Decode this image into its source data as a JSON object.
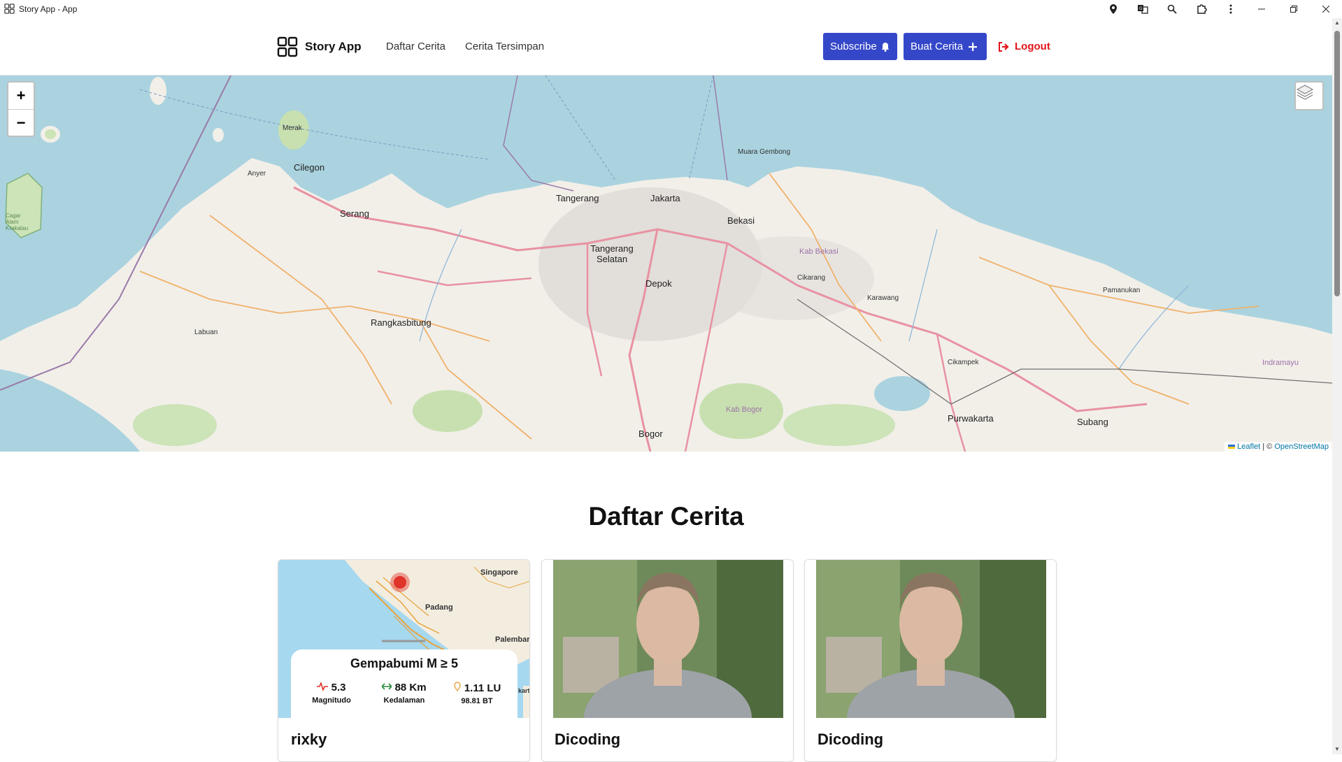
{
  "window": {
    "title": "Story App - App"
  },
  "nav": {
    "brand": "Story App",
    "links": [
      "Daftar Cerita",
      "Cerita Tersimpan"
    ],
    "subscribe": "Subscribe",
    "create": "Buat Cerita",
    "logout": "Logout"
  },
  "map": {
    "zoom_in": "+",
    "zoom_out": "−",
    "attribution_leaflet": "Leaflet",
    "attribution_sep": " | © ",
    "attribution_osm": "OpenStreetMap",
    "labels": {
      "jakarta": "Jakarta",
      "tangerang": "Tangerang",
      "tangerang_selatan": "Tangerang Selatan",
      "bekasi": "Bekasi",
      "depok": "Depok",
      "bogor": "Bogor",
      "serang": "Serang",
      "cilegon": "Cilegon",
      "rangkasbitung": "Rangkasbitung",
      "purwakarta": "Purwakarta",
      "subang": "Subang",
      "karawang": "Karawang",
      "cikampek": "Cikampek",
      "pulau_merak": "Merak",
      "cagar_alam": "Cagar Alam Krakatau",
      "kab_bekasi": "Kab Bekasi",
      "kab_bogor": "Kab Bogor",
      "indramayu": "Indramayu",
      "muara_gembong": "Muara Gembong",
      "pamanukan": "Pamanukan",
      "anyer": "Anyer",
      "labuan": "Labuan",
      "cikarang": "Cikarang"
    }
  },
  "section": {
    "title": "Daftar Cerita"
  },
  "cards": [
    {
      "title": "rixky",
      "quake": {
        "title": "Gempabumi M ≥ 5",
        "magnitude": "5.3",
        "magnitude_label": "Magnitudo",
        "depth": "88 Km",
        "depth_label": "Kedalaman",
        "location": "1.11 LU",
        "location_sub": "98.81 BT",
        "places": {
          "singapore": "Singapore",
          "padang": "Padang",
          "palembang": "Palembar",
          "kart": "kart"
        }
      }
    },
    {
      "title": "Dicoding"
    },
    {
      "title": "Dicoding"
    }
  ],
  "colors": {
    "primary": "#3547c9",
    "logout": "#e3141c",
    "sea": "#aad3df",
    "land": "#f2efe9"
  }
}
